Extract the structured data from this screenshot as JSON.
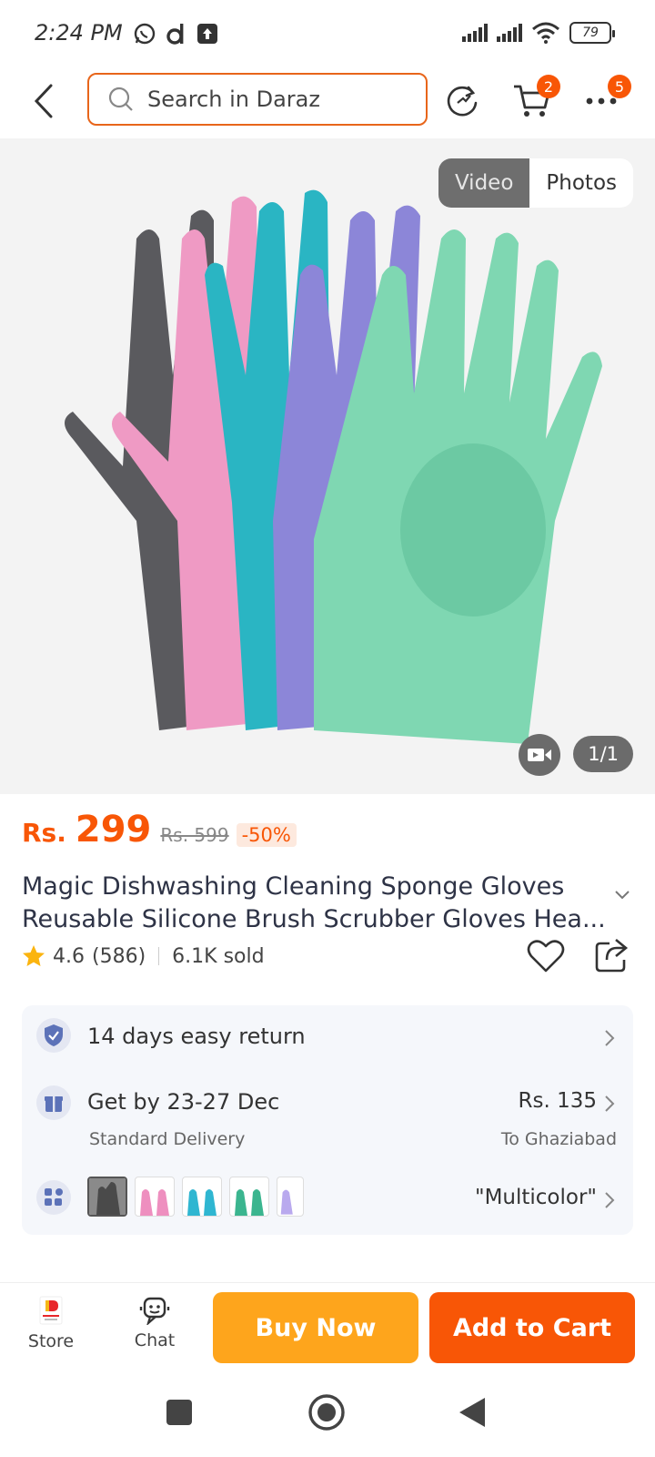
{
  "status_bar": {
    "time": "2:24 PM",
    "battery": "79"
  },
  "header": {
    "search_placeholder": "Search in Daraz",
    "cart_badge": "2",
    "more_badge": "5"
  },
  "gallery": {
    "tab_video": "Video",
    "tab_photos": "Photos",
    "counter": "1/1",
    "glove_colors": [
      "#5a5a5e",
      "#ef9ac4",
      "#2ab5c3",
      "#8c86d8",
      "#7fd7b2"
    ]
  },
  "product": {
    "currency": "Rs.",
    "price": "299",
    "old_price": "Rs. 599",
    "discount": "-50%",
    "title_line1": "Magic Dishwashing Cleaning Sponge Gloves",
    "title_line2": "Reusable Silicone Brush Scrubber Gloves Hea...",
    "rating": "4.6",
    "reviews": "(586)",
    "sold": "6.1K sold"
  },
  "info": {
    "return_text": "14 days easy return",
    "delivery_text": "Get by 23-27 Dec",
    "delivery_sub": "Standard Delivery",
    "delivery_fee": "Rs. 135",
    "delivery_to": "To Ghaziabad",
    "variant_selected": "\"Multicolor\"",
    "swatch_colors": [
      "#4a4a4a",
      "#ee8fbf",
      "#2fb6d1",
      "#3bb58f",
      "#b9a9ee"
    ]
  },
  "actions": {
    "store_label": "Store",
    "chat_label": "Chat",
    "buy_now": "Buy Now",
    "add_to_cart": "Add to Cart"
  },
  "colors": {
    "accent": "#f85606",
    "buy_now_bg": "#fea51c",
    "search_border": "#e8651a"
  }
}
